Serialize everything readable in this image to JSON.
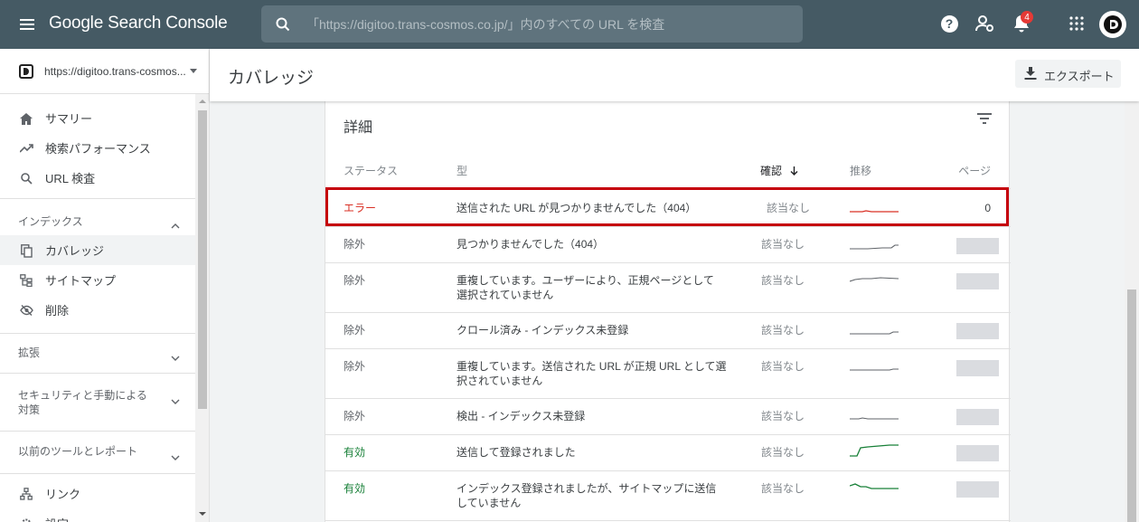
{
  "app": {
    "title": "Google Search Console"
  },
  "search": {
    "placeholder": "「https://digitoo.trans-cosmos.co.jp/」内のすべての URL を検査"
  },
  "notifications": {
    "count": "4"
  },
  "sidebar": {
    "property": "https://digitoo.trans-cosmos...",
    "top_items": [
      {
        "label": "サマリー",
        "icon": "home-icon"
      },
      {
        "label": "検索パフォーマンス",
        "icon": "trending-up-icon"
      },
      {
        "label": "URL 検査",
        "icon": "search-icon"
      }
    ],
    "index_section": {
      "title": "インデックス",
      "items": [
        {
          "label": "カバレッジ",
          "icon": "copy-icon",
          "active": true
        },
        {
          "label": "サイトマップ",
          "icon": "sitemap-icon"
        },
        {
          "label": "削除",
          "icon": "visibility-off-icon"
        }
      ]
    },
    "sections": [
      {
        "title": "拡張"
      },
      {
        "title_line1": "セキュリティと手動による",
        "title_line2": "対策"
      },
      {
        "title": "以前のツールとレポート"
      }
    ],
    "bottom_items": [
      {
        "label": "リンク",
        "icon": "links-icon"
      },
      {
        "label": "設定",
        "icon": "settings-icon"
      }
    ]
  },
  "header": {
    "title": "カバレッジ",
    "export_label": "エクスポート"
  },
  "details": {
    "title": "詳細",
    "columns": {
      "status": "ステータス",
      "type": "型",
      "verify": "確認",
      "trend": "推移",
      "pages": "ページ"
    },
    "rows": [
      {
        "status": "エラー",
        "status_kind": "error",
        "type": "送信された URL が見つかりませんでした（404）",
        "verify": "該当なし",
        "trend_color": "#d93025",
        "pages": "0"
      },
      {
        "status": "除外",
        "status_kind": "excluded",
        "type": "見つかりませんでした（404）",
        "verify": "該当なし",
        "trend_color": "#5f6368"
      },
      {
        "status": "除外",
        "status_kind": "excluded",
        "type_line1": "重複しています。ユーザーにより、正規ページとして",
        "type_line2": "選択されていません",
        "verify": "該当なし",
        "trend_color": "#5f6368"
      },
      {
        "status": "除外",
        "status_kind": "excluded",
        "type": "クロール済み - インデックス未登録",
        "verify": "該当なし",
        "trend_color": "#5f6368"
      },
      {
        "status": "除外",
        "status_kind": "excluded",
        "type_line1": "重複しています。送信された URL が正規 URL として選",
        "type_line2": "択されていません",
        "verify": "該当なし",
        "trend_color": "#5f6368"
      },
      {
        "status": "除外",
        "status_kind": "excluded",
        "type": "検出 - インデックス未登録",
        "verify": "該当なし",
        "trend_color": "#5f6368"
      },
      {
        "status": "有効",
        "status_kind": "valid",
        "type": "送信して登録されました",
        "verify": "該当なし",
        "trend_color": "#188038"
      },
      {
        "status": "有効",
        "status_kind": "valid",
        "type_line1": "インデックス登録されましたが、サイトマップに送信",
        "type_line2": "していません",
        "verify": "該当なし",
        "trend_color": "#188038"
      }
    ]
  },
  "colors": {
    "topbar": "#455a64",
    "error": "#d93025",
    "valid": "#188038",
    "highlight": "#c5000b"
  }
}
